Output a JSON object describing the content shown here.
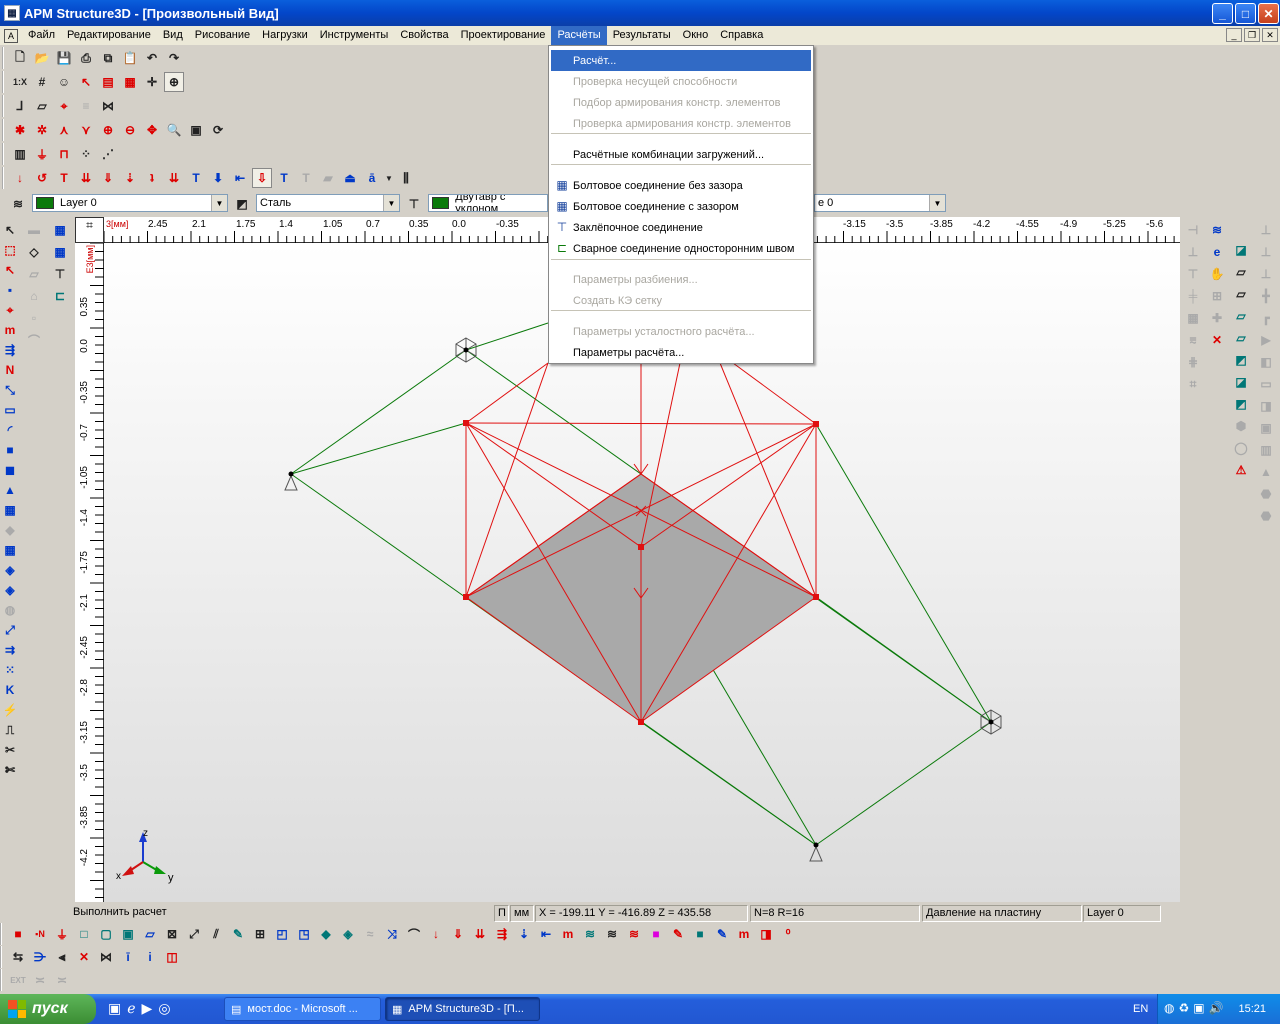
{
  "window": {
    "title": "APM Structure3D - [Произвольный Вид]"
  },
  "menubar": {
    "items": [
      "Файл",
      "Редактирование",
      "Вид",
      "Рисование",
      "Нагрузки",
      "Инструменты",
      "Свойства",
      "Проектирование",
      "Расчёты",
      "Результаты",
      "Окно",
      "Справка"
    ],
    "active": "Расчёты"
  },
  "toolbar": {
    "layer_combo": "Layer 0",
    "material_combo": "Сталь",
    "section_combo": "Двутавр с уклоном",
    "right_combo_tail": "e 0"
  },
  "menu": {
    "items": [
      {
        "label": "Расчёт...",
        "state": "selected"
      },
      {
        "label": "Проверка несущей способности",
        "state": "disabled"
      },
      {
        "label": "Подбор армирования констр. элементов",
        "state": "disabled"
      },
      {
        "label": "Проверка армирования констр. элементов",
        "state": "disabled"
      },
      {
        "label": "Расчётные комбинации загружений...",
        "state": "enabled"
      },
      {
        "label": "Болтовое соединение без зазора",
        "state": "enabled",
        "icon": "bolt-grid-icon"
      },
      {
        "label": "Болтовое соединение с зазором",
        "state": "enabled",
        "icon": "bolt-grid-icon"
      },
      {
        "label": "Заклёпочное соединение",
        "state": "enabled",
        "icon": "rivet-icon"
      },
      {
        "label": "Сварное соединение односторонним швом",
        "state": "enabled",
        "icon": "weld-icon"
      },
      {
        "label": "Параметры разбиения...",
        "state": "disabled"
      },
      {
        "label": "Создать КЭ сетку",
        "state": "disabled"
      },
      {
        "label": "Параметры усталостного расчёта...",
        "state": "disabled"
      },
      {
        "label": "Параметры расчёта...",
        "state": "enabled"
      }
    ]
  },
  "ruler": {
    "unit": "3[мм]",
    "h_ticks": [
      "2.45",
      "2.1",
      "1.75",
      "1.4",
      "1.05",
      "0.7",
      "0.35",
      "0.0",
      "-0.35",
      "-3.15",
      "-3.5",
      "-3.85",
      "-4.2",
      "-4.55",
      "-4.9",
      "-5.25",
      "-5.6"
    ],
    "v_unit": "E3[мм]",
    "v_ticks": [
      "0.35",
      "0.0",
      "-0.35",
      "-0.7",
      "-1.05",
      "-1.4",
      "-1.75",
      "-2.1",
      "-2.45",
      "-2.8",
      "-3.15",
      "-3.5",
      "-3.85",
      "-4.2"
    ]
  },
  "axes": {
    "x": "x",
    "y": "y",
    "z": "z"
  },
  "status": {
    "hint": "Выполнить расчет",
    "mode1": "П",
    "unit": "мм",
    "coords": "X = -199.11 Y = -416.89 Z = 435.58",
    "counts": "N=8 R=16",
    "load_type": "Давление на пластину",
    "layer": "Layer 0"
  },
  "taskbar": {
    "start": "пуск",
    "tasks": [
      "мост.doc - Microsoft ...",
      "APM Structure3D - [П..."
    ],
    "lang": "EN",
    "clock": "15:21"
  },
  "colors": {
    "menu_highlight": "#316ac5",
    "model_red": "#e01010",
    "model_green": "#0b7a0b",
    "plate": "#a9a9a9"
  }
}
